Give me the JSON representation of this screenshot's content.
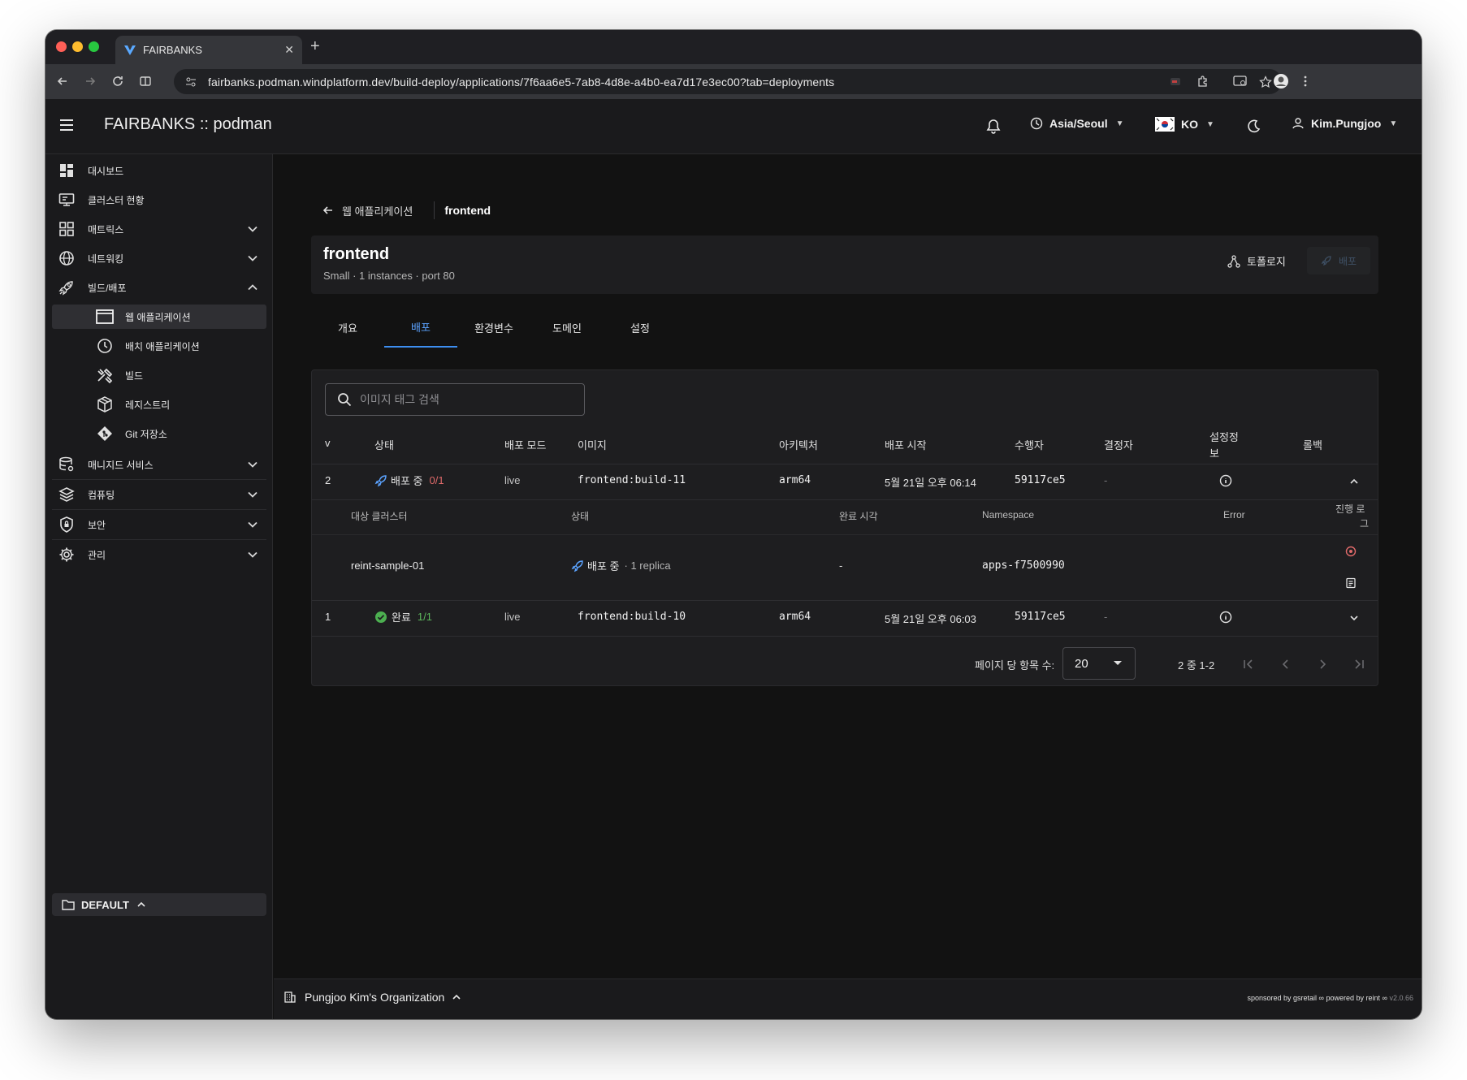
{
  "browser": {
    "tab_title": "FAIRBANKS",
    "url": "fairbanks.podman.windplatform.dev/build-deploy/applications/7f6aa6e5-7ab8-4d8e-a4b0-ea7d17e3ec00?tab=deployments"
  },
  "header": {
    "app_title": "FAIRBANKS :: podman",
    "timezone": "Asia/Seoul",
    "language": "KO",
    "user": "Kim.Pungjoo"
  },
  "sidebar": {
    "items": [
      {
        "label": "대시보드",
        "icon": "dashboard-icon"
      },
      {
        "label": "클러스터 현황",
        "icon": "monitor-icon"
      },
      {
        "label": "매트릭스",
        "icon": "grid-icon"
      },
      {
        "label": "네트워킹",
        "icon": "globe-icon"
      },
      {
        "label": "빌드/배포",
        "icon": "rocket-icon"
      }
    ],
    "build_sub": [
      {
        "label": "웹 애플리케이션",
        "icon": "window-icon"
      },
      {
        "label": "배치 애플리케이션",
        "icon": "clock-icon"
      },
      {
        "label": "빌드",
        "icon": "tools-icon"
      },
      {
        "label": "레지스트리",
        "icon": "package-icon"
      },
      {
        "label": "Git 저장소",
        "icon": "git-icon"
      }
    ],
    "lower": [
      {
        "label": "매니지드 서비스",
        "icon": "database-icon"
      },
      {
        "label": "컴퓨팅",
        "icon": "layers-icon"
      },
      {
        "label": "보안",
        "icon": "shield-icon"
      },
      {
        "label": "관리",
        "icon": "gear-icon"
      }
    ],
    "workspace": "DEFAULT"
  },
  "breadcrumb": {
    "back": "웹 애플리케이션",
    "current": "frontend"
  },
  "app": {
    "name": "frontend",
    "meta": "Small · 1 instances · port 80",
    "topology": "토폴로지",
    "deploy": "배포"
  },
  "tabs": [
    "개요",
    "배포",
    "환경변수",
    "도메인",
    "설정"
  ],
  "search": {
    "placeholder": "이미지 태그 검색"
  },
  "table": {
    "headers": {
      "v": "v",
      "status": "상태",
      "mode": "배포 모드",
      "image": "이미지",
      "arch": "아키텍처",
      "start": "배포 시작",
      "executor": "수행자",
      "approver": "결정자",
      "config_l1": "설정정",
      "config_l2": "보",
      "rollback": "롤백"
    },
    "rows": [
      {
        "v": "2",
        "status": "배포 중",
        "count": "0/1",
        "mode": "live",
        "image": "frontend:build-11",
        "arch": "arm64",
        "start": "5월 21일 오후 06:14",
        "executor": "59117ce5",
        "approver": "-"
      },
      {
        "v": "1",
        "status": "완료",
        "count": "1/1",
        "mode": "live",
        "image": "frontend:build-10",
        "arch": "arm64",
        "start": "5월 21일 오후 06:03",
        "executor": "59117ce5",
        "approver": "-"
      }
    ],
    "sub_headers": {
      "cluster": "대상 클러스터",
      "status": "상태",
      "done": "완료 시각",
      "namespace": "Namespace",
      "error": "Error",
      "log_l1": "진행 로",
      "log_l2": "그"
    },
    "sub_row": {
      "cluster": "reint-sample-01",
      "status": "배포 중",
      "replica": "· 1 replica",
      "done": "-",
      "namespace": "apps-f7500990"
    }
  },
  "pagination": {
    "label": "페이지 당 항목 수:",
    "per_page": "20",
    "range": "2 중 1-2"
  },
  "footer": {
    "org": "Pungjoo Kim's Organization",
    "sponsored": "sponsored by gsretail",
    "powered": "powered by reint",
    "version": "v2.0.66"
  },
  "colors": {
    "accent": "#3d8ef0",
    "in_progress": "#e06a6a",
    "success": "#4caf50",
    "bg": "#121212"
  }
}
